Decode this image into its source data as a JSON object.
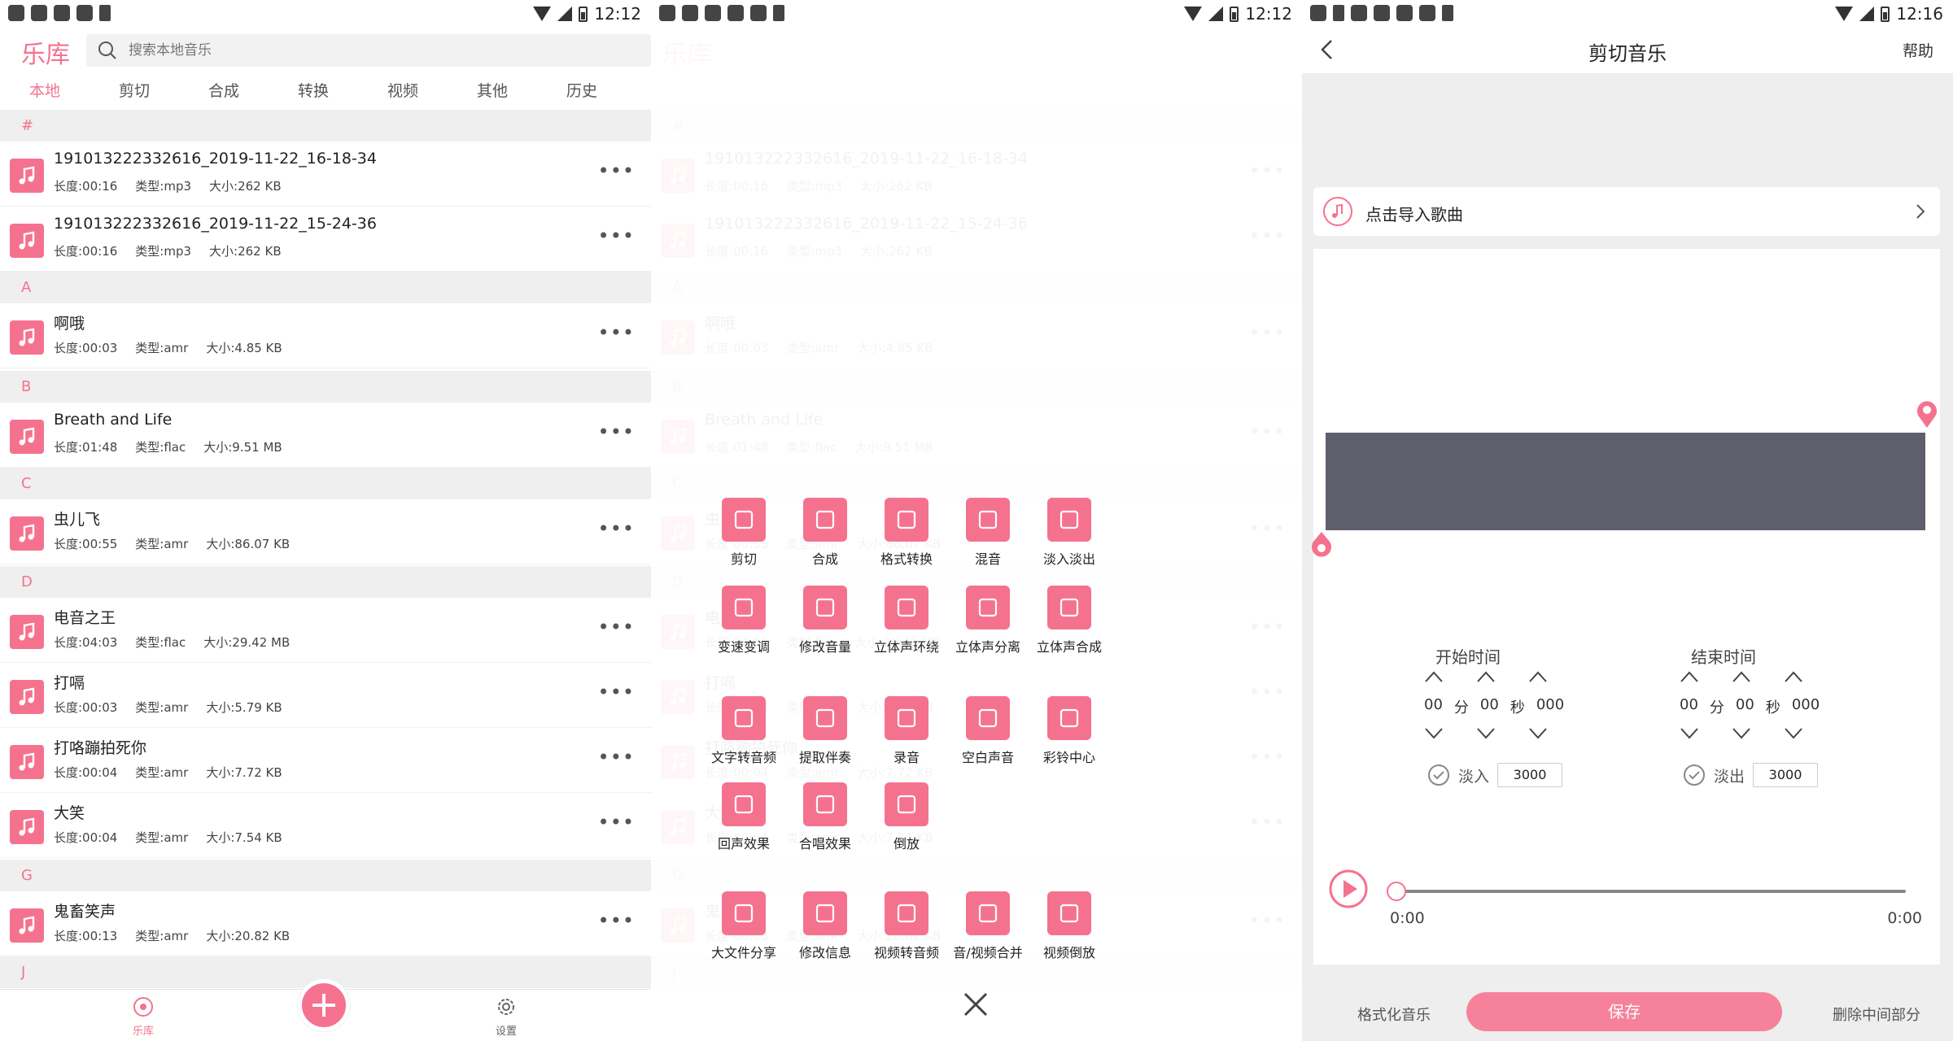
{
  "status": [
    {
      "time": "12:12"
    },
    {
      "time": "12:12"
    },
    {
      "time": "12:16"
    }
  ],
  "library": {
    "title": "乐库",
    "search_placeholder": "搜索本地音乐",
    "tabs": [
      {
        "label": "本地",
        "active": true
      },
      {
        "label": "剪切"
      },
      {
        "label": "合成"
      },
      {
        "label": "转换"
      },
      {
        "label": "视频"
      },
      {
        "label": "其他"
      },
      {
        "label": "历史"
      }
    ],
    "sections": [
      "#",
      "A",
      "B",
      "C",
      "D",
      "G",
      "J"
    ],
    "songs": [
      {
        "title": "191013222332616_2019-11-22_16-18-34",
        "length": "长度:00:16",
        "type": "类型:mp3",
        "size": "大小:262 KB"
      },
      {
        "title": "191013222332616_2019-11-22_15-24-36",
        "length": "长度:00:16",
        "type": "类型:mp3",
        "size": "大小:262 KB"
      },
      {
        "title": "啊哦",
        "length": "长度:00:03",
        "type": "类型:amr",
        "size": "大小:4.85 KB"
      },
      {
        "title": "Breath and Life",
        "length": "长度:01:48",
        "type": "类型:flac",
        "size": "大小:9.51 MB"
      },
      {
        "title": "虫儿飞",
        "length": "长度:00:55",
        "type": "类型:amr",
        "size": "大小:86.07 KB"
      },
      {
        "title": "电音之王",
        "length": "长度:04:03",
        "type": "类型:flac",
        "size": "大小:29.42 MB"
      },
      {
        "title": "打嗝",
        "length": "长度:00:03",
        "type": "类型:amr",
        "size": "大小:5.79 KB"
      },
      {
        "title": "打咯蹦拍死你",
        "length": "长度:00:04",
        "type": "类型:amr",
        "size": "大小:7.72 KB"
      },
      {
        "title": "大笑",
        "length": "长度:00:04",
        "type": "类型:amr",
        "size": "大小:7.54 KB"
      },
      {
        "title": "鬼畜笑声",
        "length": "长度:00:13",
        "type": "类型:amr",
        "size": "大小:20.82 KB"
      }
    ],
    "more": "•••",
    "nav": {
      "library": "乐库",
      "settings": "设置"
    }
  },
  "menu": {
    "items": [
      "剪切",
      "合成",
      "格式转换",
      "混音",
      "淡入淡出",
      "变速变调",
      "修改音量",
      "立体声环绕",
      "立体声分离",
      "立体声合成",
      "文字转音频",
      "提取伴奏",
      "录音",
      "空白声音",
      "彩铃中心",
      "回声效果",
      "合唱效果",
      "倒放",
      "大文件分享",
      "修改信息",
      "视频转音频",
      "音/视频合并",
      "视频倒放"
    ]
  },
  "cutter": {
    "title": "剪切音乐",
    "help": "帮助",
    "import": "点击导入歌曲",
    "start_label": "开始时间",
    "end_label": "结束时间",
    "start": {
      "m": "00",
      "min_unit": "分",
      "s": "00",
      "sec_unit": "秒",
      "ms": "000"
    },
    "end": {
      "m": "00",
      "min_unit": "分",
      "s": "00",
      "sec_unit": "秒",
      "ms": "000"
    },
    "fade_in_label": "淡入",
    "fade_in_value": "3000",
    "fade_out_label": "淡出",
    "fade_out_value": "3000",
    "time_left": "0:00",
    "time_right": "0:00",
    "format_btn": "格式化音乐",
    "save_btn": "保存",
    "delete_mid_btn": "删除中间部分"
  },
  "colors": {
    "accent": "#f5728e",
    "wave": "#5f5e6c"
  }
}
